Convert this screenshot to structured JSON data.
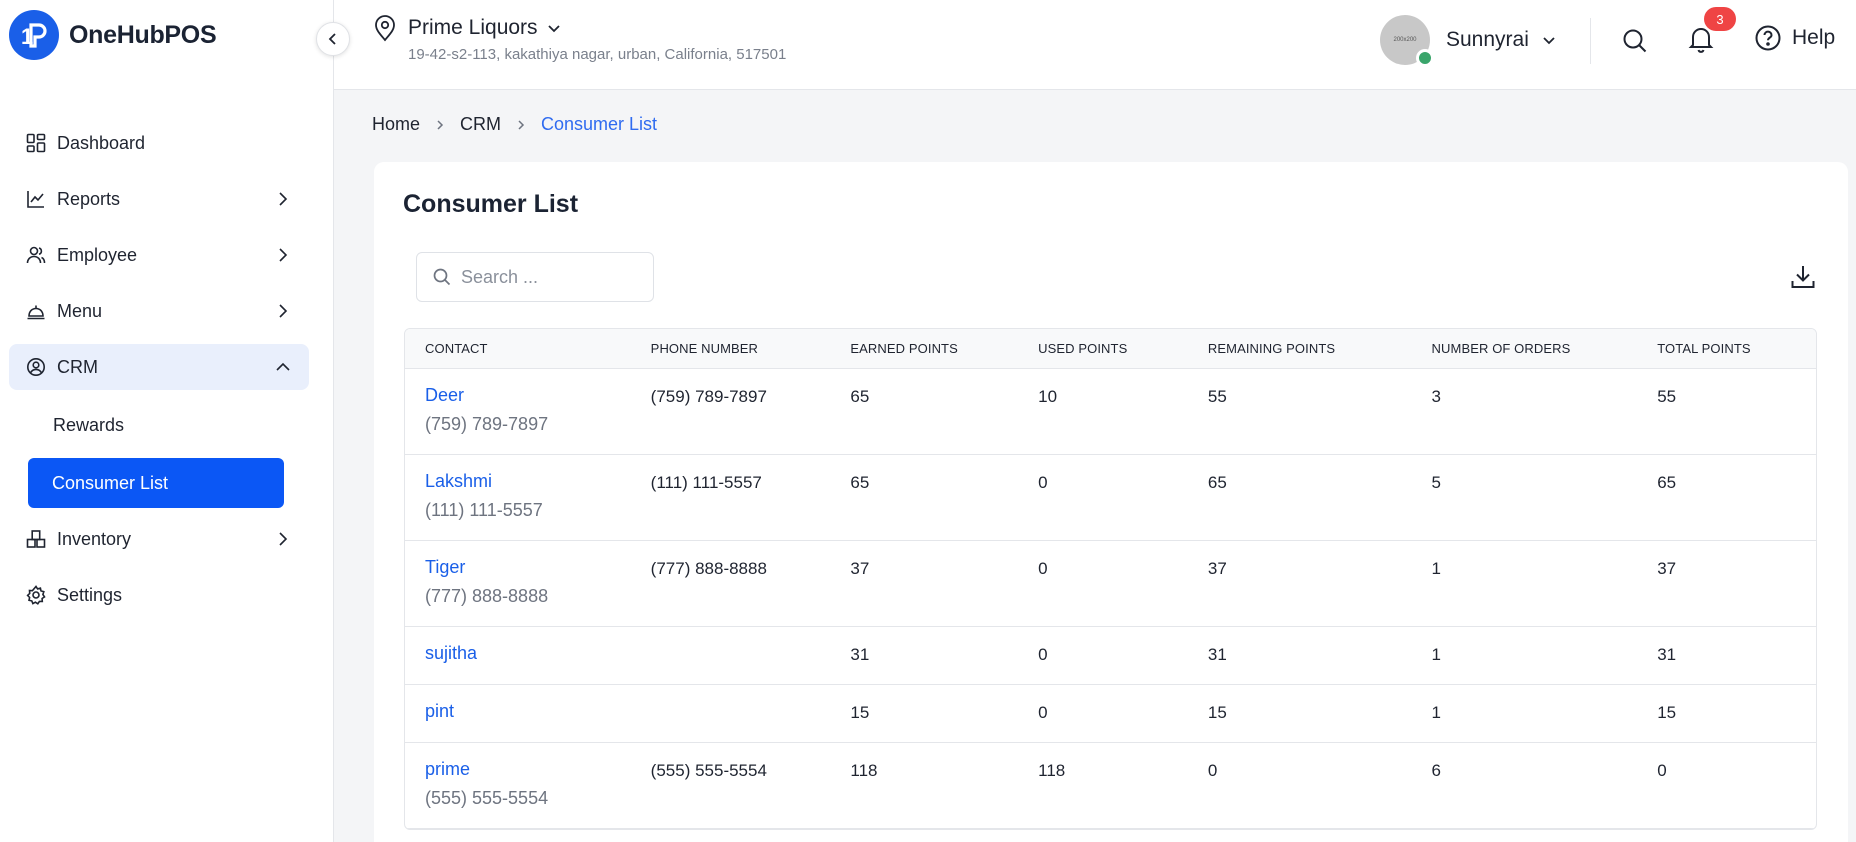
{
  "brand": {
    "name": "OneHubPOS",
    "logo_color": "#1a5fe8"
  },
  "sidebar": {
    "items": [
      {
        "label": "Dashboard",
        "icon": "dashboard-icon",
        "has_children": false
      },
      {
        "label": "Reports",
        "icon": "reports-chart-icon",
        "has_children": true
      },
      {
        "label": "Employee",
        "icon": "employee-users-icon",
        "has_children": true
      },
      {
        "label": "Menu",
        "icon": "menu-cloche-icon",
        "has_children": true
      },
      {
        "label": "CRM",
        "icon": "crm-icon",
        "has_children": true,
        "expanded": true,
        "children": [
          {
            "label": "Rewards"
          },
          {
            "label": "Consumer List",
            "selected": true
          }
        ]
      },
      {
        "label": "Inventory",
        "icon": "inventory-boxes-icon",
        "has_children": true
      },
      {
        "label": "Settings",
        "icon": "gear-icon",
        "has_children": false
      }
    ]
  },
  "header": {
    "store_name": "Prime Liquors",
    "store_address": "19-42-s2-113, kakathiya nagar, urban, California, 517501",
    "avatar_placeholder": "200x200",
    "user_name": "Sunnyrai",
    "notification_count": "3",
    "help_label": "Help"
  },
  "breadcrumb": {
    "home": "Home",
    "section": "CRM",
    "current": "Consumer List"
  },
  "page": {
    "title": "Consumer List",
    "search_placeholder": "Search ...",
    "columns": {
      "contact": "CONTACT",
      "phone": "PHONE NUMBER",
      "earned": "EARNED POINTS",
      "used": "USED POINTS",
      "remaining": "REMAINING POINTS",
      "orders": "NUMBER OF ORDERS",
      "total": "TOTAL POINTS"
    },
    "rows": [
      {
        "name": "Deer",
        "contact_phone": "(759) 789-7897",
        "phone": "(759) 789-7897",
        "earned": "65",
        "used": "10",
        "remaining": "55",
        "orders": "3",
        "total": "55"
      },
      {
        "name": "Lakshmi",
        "contact_phone": "(111) 111-5557",
        "phone": "(111) 111-5557",
        "earned": "65",
        "used": "0",
        "remaining": "65",
        "orders": "5",
        "total": "65"
      },
      {
        "name": "Tiger",
        "contact_phone": "(777) 888-8888",
        "phone": "(777) 888-8888",
        "earned": "37",
        "used": "0",
        "remaining": "37",
        "orders": "1",
        "total": "37"
      },
      {
        "name": "sujitha",
        "contact_phone": "",
        "phone": "",
        "earned": "31",
        "used": "0",
        "remaining": "31",
        "orders": "1",
        "total": "31"
      },
      {
        "name": "pint",
        "contact_phone": "",
        "phone": "",
        "earned": "15",
        "used": "0",
        "remaining": "15",
        "orders": "1",
        "total": "15"
      },
      {
        "name": "prime",
        "contact_phone": "(555) 555-5554",
        "phone": "(555) 555-5554",
        "earned": "118",
        "used": "118",
        "remaining": "0",
        "orders": "6",
        "total": "0"
      }
    ]
  },
  "colors": {
    "accent": "#0b57f5",
    "link": "#1a5fe8",
    "badge": "#ef4444",
    "online": "#3aa56b"
  }
}
